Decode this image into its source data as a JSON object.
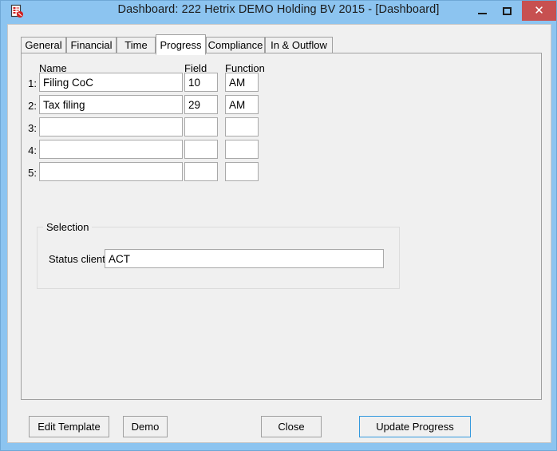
{
  "window": {
    "title": "Dashboard: 222 Hetrix DEMO Holding BV 2015 - [Dashboard]",
    "app_icon_name": "form-document-icon",
    "controls": {
      "minimize_label": "–",
      "maximize_label": "□",
      "close_label": "✕"
    },
    "colors": {
      "titlebar": "#8cc4f0",
      "close_button": "#c75050",
      "client_background": "#f0f0f0",
      "focus_border": "#3399de"
    }
  },
  "tabs": [
    {
      "label": "General",
      "active": false
    },
    {
      "label": "Financial",
      "active": false
    },
    {
      "label": "Time",
      "active": false
    },
    {
      "label": "Progress",
      "active": true
    },
    {
      "label": "Compliance",
      "active": false
    },
    {
      "label": "In & Outflow",
      "active": false
    }
  ],
  "progress_tab": {
    "columns": {
      "name": "Name",
      "field": "Field",
      "function": "Function"
    },
    "rows": [
      {
        "index": "1:",
        "name": "Filing CoC",
        "field": "10",
        "function": "AM"
      },
      {
        "index": "2:",
        "name": "Tax filing",
        "field": "29",
        "function": "AM"
      },
      {
        "index": "3:",
        "name": "",
        "field": "",
        "function": ""
      },
      {
        "index": "4:",
        "name": "",
        "field": "",
        "function": ""
      },
      {
        "index": "5:",
        "name": "",
        "field": "",
        "function": ""
      }
    ],
    "selection": {
      "title": "Selection",
      "status_client_label": "Status client",
      "status_client_value": "ACT"
    }
  },
  "footer": {
    "edit_template": "Edit Template",
    "demo": "Demo",
    "close": "Close",
    "update_progress": "Update Progress"
  }
}
